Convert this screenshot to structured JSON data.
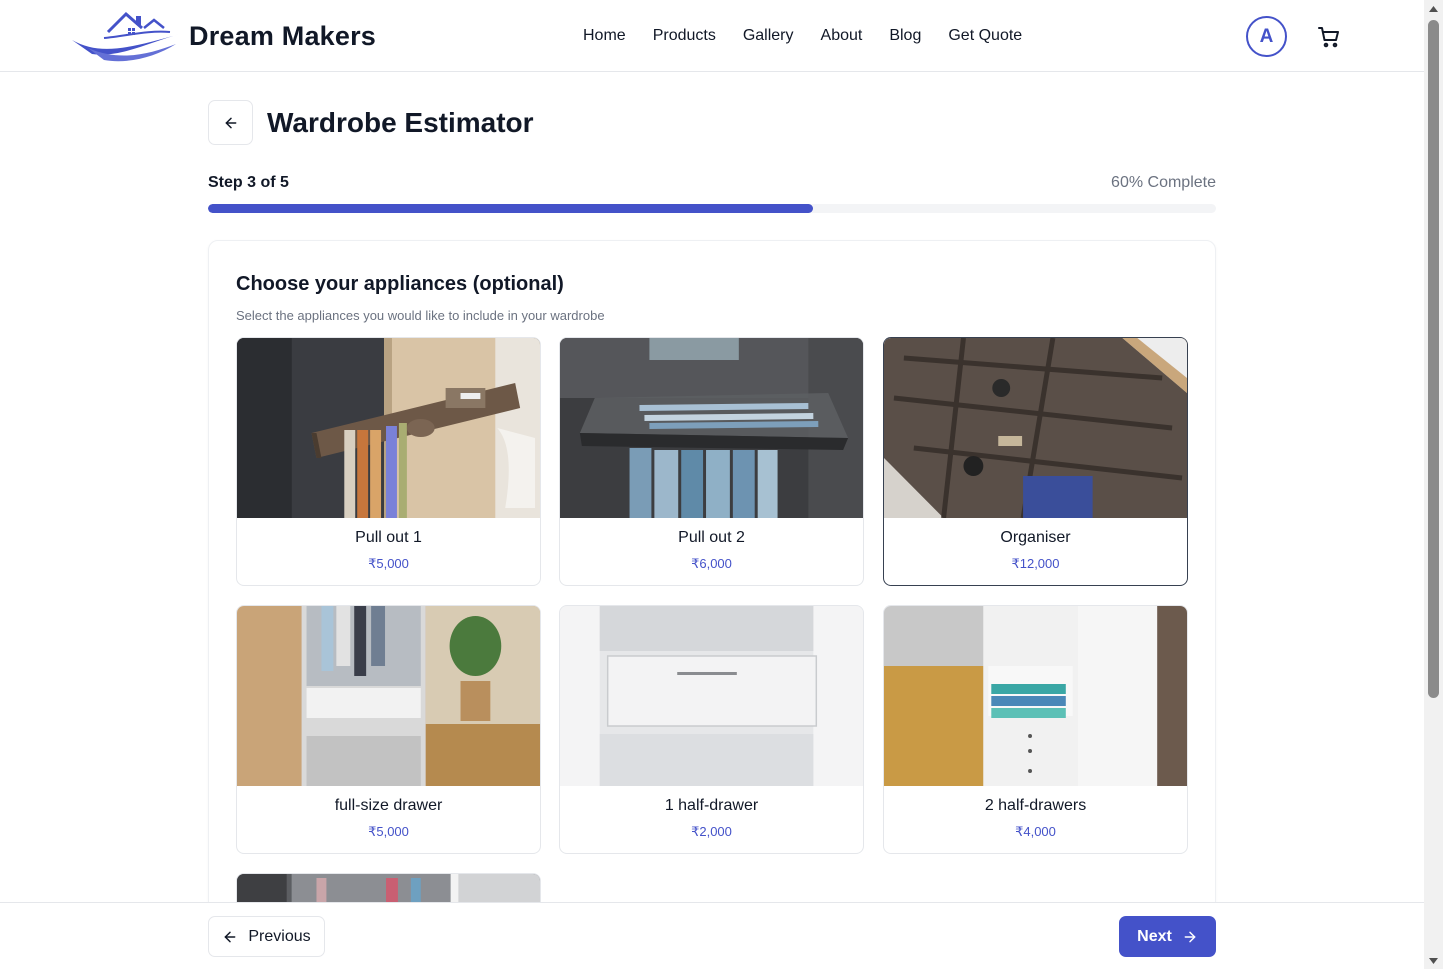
{
  "brand": {
    "name": "Dream Makers"
  },
  "nav": {
    "items": [
      "Home",
      "Products",
      "Gallery",
      "About",
      "Blog",
      "Get Quote"
    ]
  },
  "user": {
    "initial": "A"
  },
  "page": {
    "title": "Wardrobe Estimator"
  },
  "progress": {
    "step_text": "Step 3 of 5",
    "percent_text": "60% Complete",
    "value": 0.6
  },
  "section": {
    "title": "Choose your appliances (optional)",
    "subtitle": "Select the appliances you would like to include in your wardrobe"
  },
  "appliances": [
    {
      "name": "Pull out 1",
      "price": "₹5,000",
      "selected": false
    },
    {
      "name": "Pull out 2",
      "price": "₹6,000",
      "selected": false
    },
    {
      "name": "Organiser",
      "price": "₹12,000",
      "selected": true
    },
    {
      "name": "full-size drawer",
      "price": "₹5,000",
      "selected": false
    },
    {
      "name": "1 half-drawer",
      "price": "₹2,000",
      "selected": false
    },
    {
      "name": "2 half-drawers",
      "price": "₹4,000",
      "selected": false
    }
  ],
  "footer": {
    "previous_label": "Previous",
    "next_label": "Next"
  },
  "colors": {
    "accent": "#4452c9",
    "text": "#111827",
    "muted": "#6b7280",
    "border": "#e5e7eb"
  },
  "icons": {
    "back": "arrow-left-icon",
    "cart": "shopping-cart-icon",
    "next": "arrow-right-icon"
  }
}
